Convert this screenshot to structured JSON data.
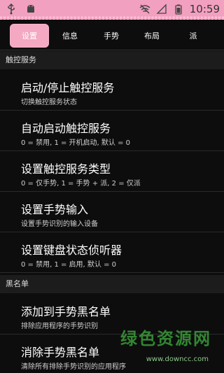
{
  "status_bar": {
    "time": "10:59",
    "icons": [
      "usb-icon",
      "android-icon",
      "wifi-off-icon",
      "signal-icon",
      "battery-icon"
    ]
  },
  "tabs": [
    {
      "label": "设置",
      "active": true
    },
    {
      "label": "信息",
      "active": false
    },
    {
      "label": "手势",
      "active": false
    },
    {
      "label": "布局",
      "active": false
    },
    {
      "label": "派",
      "active": false
    }
  ],
  "sections": [
    {
      "header": "触控服务",
      "items": [
        {
          "title": "启动/停止触控服务",
          "subtitle": "切换触控服务状态"
        },
        {
          "title": "自动启动触控服务",
          "subtitle": "0 = 禁用, 1 = 开机启动, 默认 = 0"
        },
        {
          "title": "设置触控服务类型",
          "subtitle": "0 = 仅手势, 1 = 手势 + 派, 2 = 仅派"
        },
        {
          "title": "设置手势输入",
          "subtitle": "设置手势识别的输入设备"
        },
        {
          "title": "设置键盘状态侦听器",
          "subtitle": "0 = 禁用, 1 = 启用, 默认 = 0"
        }
      ]
    },
    {
      "header": "黑名单",
      "items": [
        {
          "title": "添加到手势黑名单",
          "subtitle": "排除应用程序的手势识别"
        },
        {
          "title": "消除手势黑名单",
          "subtitle": "清除所有排除手势识别的应用程序"
        }
      ]
    }
  ],
  "watermark": {
    "text": "绿色资源网",
    "url": "www.downcc.com"
  },
  "colors": {
    "accent_pink": "#f4a8c2",
    "background": "#0d0d0d"
  }
}
